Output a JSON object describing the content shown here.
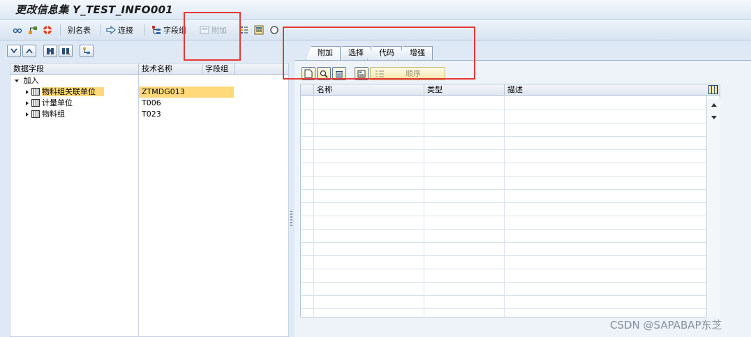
{
  "window": {
    "title": "更改信息集 Y_TEST_INFO001"
  },
  "toolbar": {
    "alias_table": "别名表",
    "join": "连接",
    "field_group": "字段组",
    "extra": "附加",
    "icons": [
      "glasses-icon",
      "hierarchy-icon",
      "lifebuoy-icon",
      "arrow-right-icon",
      "tree-icon",
      "extra-icon",
      "list-icon",
      "screen-icon",
      "circle-icon"
    ]
  },
  "left": {
    "columns": [
      "数据字段",
      "技术名称",
      "字段组"
    ],
    "tree": [
      {
        "label": "加入",
        "tech": "",
        "expanded": true,
        "level": 0
      },
      {
        "label": "物料组关联单位",
        "tech": "ZTMDG013",
        "level": 1,
        "selected": true
      },
      {
        "label": "计量单位",
        "tech": "T006",
        "level": 1
      },
      {
        "label": "物料组",
        "tech": "T023",
        "level": 1
      }
    ]
  },
  "tabs": [
    "附加",
    "选择",
    "代码",
    "增强"
  ],
  "active_tab": "附加",
  "grid": {
    "sequence_label": "顺序",
    "columns": [
      "名称",
      "类型",
      "描述"
    ]
  },
  "watermark": "CSDN @SAPABAP东芝",
  "colors": {
    "highlight": "#ffd97a",
    "annotation": "#e53935"
  }
}
